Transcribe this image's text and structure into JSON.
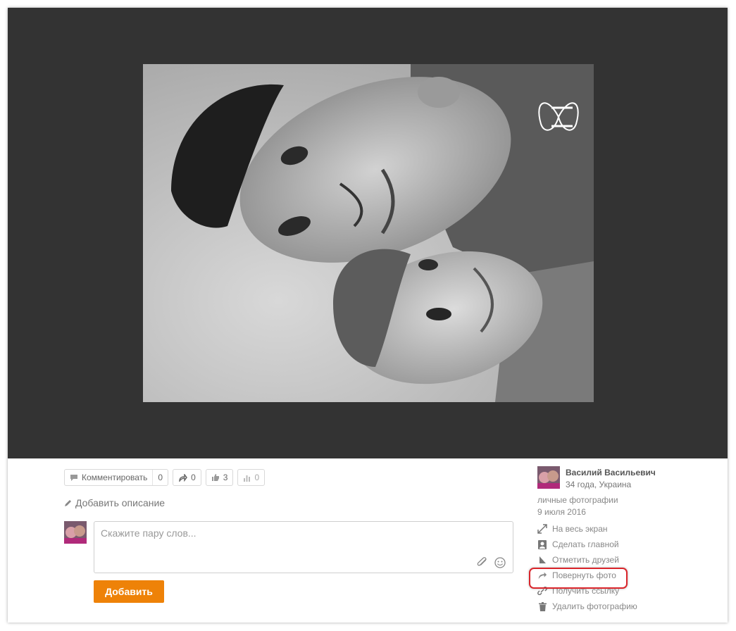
{
  "actions": {
    "comment_label": "Комментировать",
    "comment_count": "0",
    "share_count": "0",
    "like_count": "3",
    "stats_count": "0"
  },
  "add_description": "Добавить описание",
  "composer": {
    "placeholder": "Скажите пару слов...",
    "submit_label": "Добавить"
  },
  "owner": {
    "name": "Василий Васильевич",
    "meta": "34 года, Украина"
  },
  "album": "личные фотографии",
  "date": "9 июля 2016",
  "menu": [
    {
      "label": "На весь экран",
      "icon": "fullscreen-icon"
    },
    {
      "label": "Сделать главной",
      "icon": "user-card-icon"
    },
    {
      "label": "Отметить друзей",
      "icon": "tag-icon"
    },
    {
      "label": "Повернуть фото",
      "icon": "rotate-icon"
    },
    {
      "label": "Получить ссылку",
      "icon": "link-icon"
    },
    {
      "label": "Удалить фотографию",
      "icon": "trash-icon"
    }
  ],
  "colors": {
    "viewer_bg": "#333333",
    "accent": "#ee8208",
    "highlight": "#d9252b"
  }
}
